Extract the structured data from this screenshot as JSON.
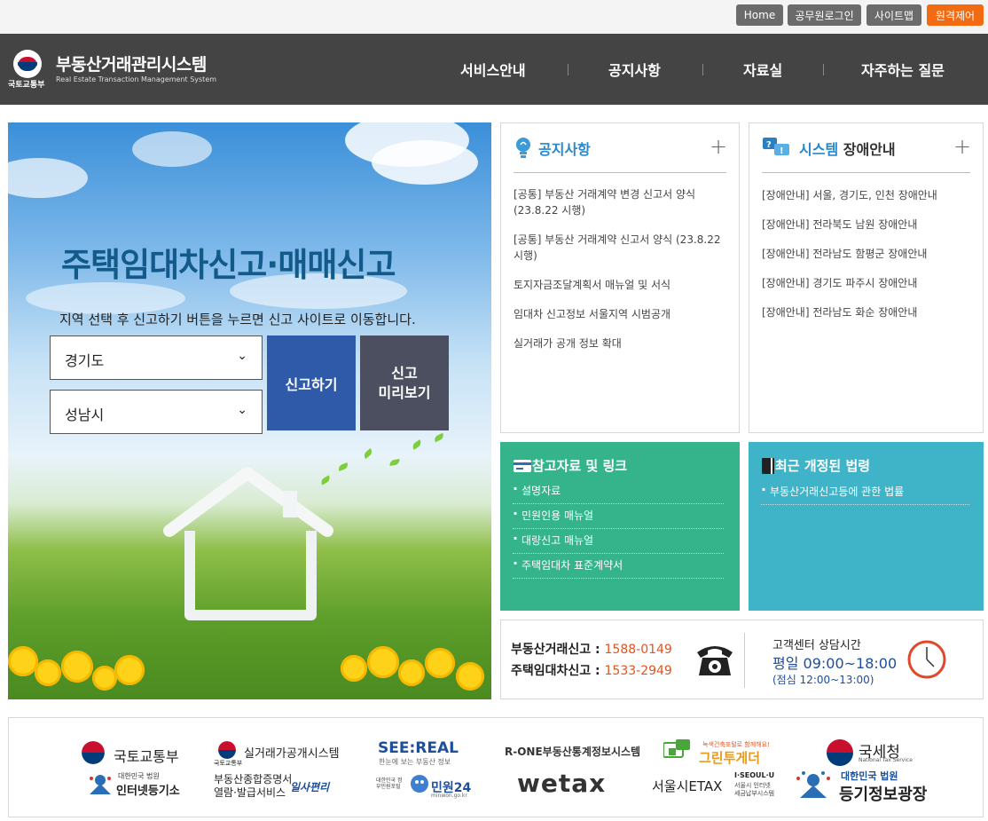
{
  "utility": {
    "home": "Home",
    "staff_login": "공무원로그인",
    "sitemap": "사이트맵",
    "remote": "원격제어"
  },
  "header": {
    "org": "국토교통부",
    "title": "부동산거래관리시스템",
    "title_en": "Real Estate Transaction Management System",
    "nav": [
      "서비스안내",
      "공지사항",
      "자료실",
      "자주하는 질문"
    ]
  },
  "hero": {
    "title": "주택임대차신고·매매신고",
    "description": "지역 선택 후 신고하기 버튼을 누르면 신고 사이트로 이동합니다.",
    "region1": "경기도",
    "region2": "성남시",
    "report_button": "신고하기",
    "preview_button": "신고\n미리보기"
  },
  "notice": {
    "title": "공지사항",
    "items": [
      "[공통] 부동산 거래계약 변경 신고서 양식 (23.8.22 시행)",
      "[공통] 부동산 거래계약 신고서 양식 (23.8.22 시행)",
      "토지자금조달계획서 매뉴얼 및 서식",
      "임대차 신고정보 서울지역 시범공개",
      "실거래가 공개 정보 확대"
    ]
  },
  "trouble": {
    "title_accent": "시스템",
    "title_rest": "장애안내",
    "items": [
      "[장애안내] 서울, 경기도, 인천 장애안내",
      "[장애안내] 전라북도 남원 장애안내",
      "[장애안내] 전라남도 함평군 장애안내",
      "[장애안내] 경기도 파주시 장애안내",
      "[장애안내] 전라남도 화순 장애안내"
    ]
  },
  "references": {
    "title": "참고자료 및 링크",
    "items": [
      "설명자료",
      "민원인용 매뉴얼",
      "대량신고 매뉴얼",
      "주택임대차 표준계약서"
    ],
    "color": "#35b48c"
  },
  "laws": {
    "title": "최근 개정된 법령",
    "items": [
      "부동산거래신고등에 관한 법률"
    ],
    "color": "#3fb4c9"
  },
  "contact": {
    "trade_label": "부동산거래신고 :",
    "trade_number": "1588-0149",
    "lease_label": "주택임대차신고 :",
    "lease_number": "1533-2949",
    "hours_title": "고객센터 상담시간",
    "hours_main": "평일 09:00~18:00",
    "hours_sub": "(점심 12:00~13:00)"
  },
  "banners": {
    "molit": "국토교통부",
    "court_small": "대한민국 법원",
    "court_registry": "인터넷등기소",
    "realprice": "실거래가공개시스템",
    "realprice_org": "국토교통부",
    "cert_line1": "부동산종합증명서",
    "cert_line2": "열람·발급서비스",
    "ilsa": "일사편리",
    "seereal": "SEE:REAL",
    "seereal_sub": "한눈에 보는 부동산 정보",
    "minwon_small": "대한민국 정부민원포털",
    "minwon": "민원24",
    "minwon_url": "minwon.go.kr",
    "rone": "R-ONE부동산통계정보시스템",
    "wetax": "wetax",
    "green_slogan": "녹색건축포털로 함께해요!",
    "green": "그린투게더",
    "seoul_etax": "서울시ETAX",
    "iseoulu": "I·SEOUL·U",
    "iseoulu_sub1": "서울시 인터넷",
    "iseoulu_sub2": "세금납부시스템",
    "nts": "국세청",
    "nts_en": "National Tax Service",
    "court2_small": "대한민국 법원",
    "court2": "등기정보광장"
  }
}
